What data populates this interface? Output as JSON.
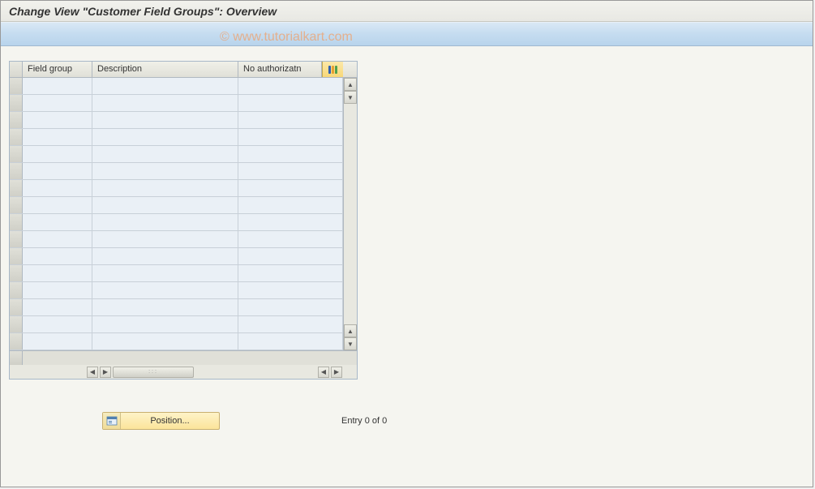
{
  "title": "Change View \"Customer Field Groups\": Overview",
  "watermark": "© www.tutorialkart.com",
  "table": {
    "columns": {
      "field_group": "Field group",
      "description": "Description",
      "no_auth": "No authorizatn"
    },
    "row_count": 16
  },
  "footer": {
    "position_label": "Position...",
    "entry_text": "Entry 0 of 0"
  }
}
